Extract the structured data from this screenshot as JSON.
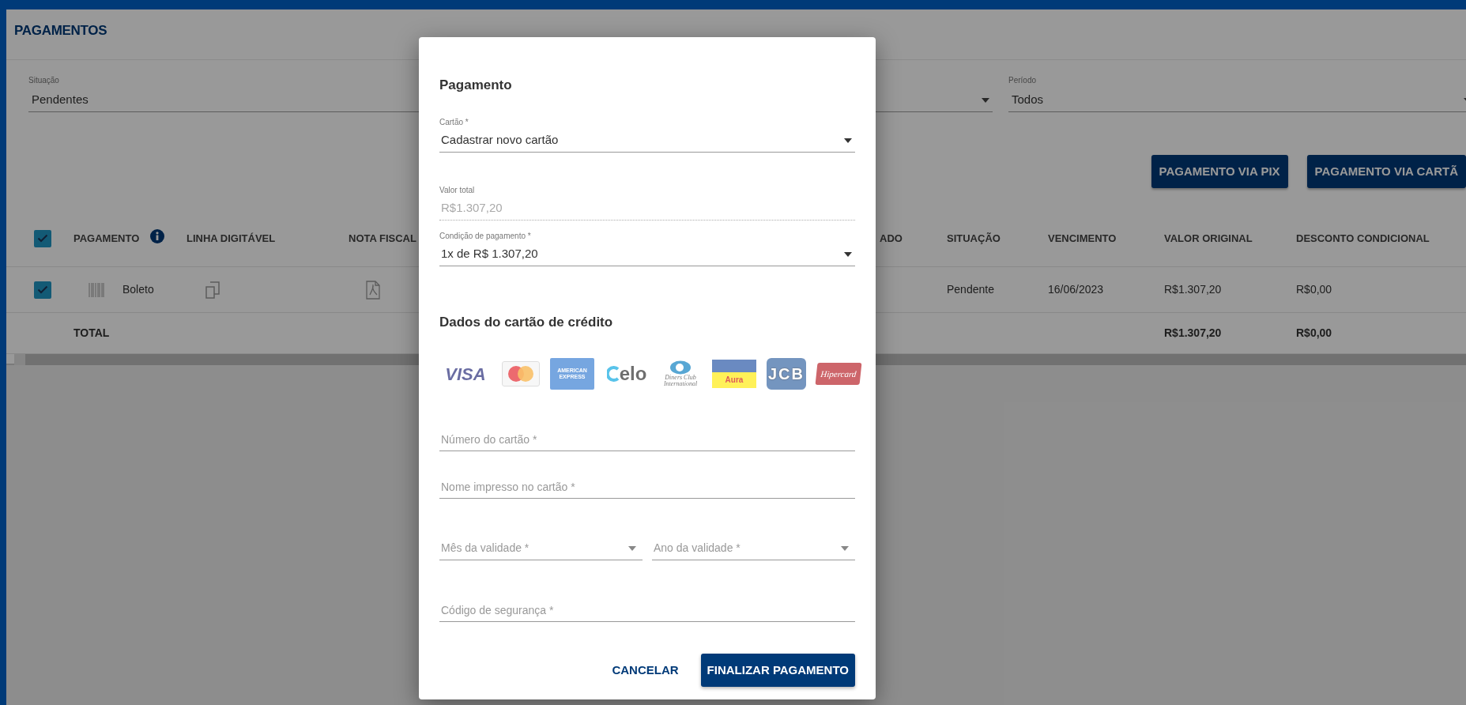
{
  "page": {
    "title": "PAGAMENTOS"
  },
  "filters": [
    {
      "kind": "text",
      "label": "Situação",
      "value": "Pendentes"
    },
    {
      "kind": "select"
    },
    {
      "kind": "select",
      "label": "Período",
      "value": "Todos"
    }
  ],
  "actions": [
    "PAGAMENTO VIA PIX",
    "PAGAMENTO VIA CARTÃ"
  ],
  "table": {
    "select_all_checked": true,
    "columns": [
      {
        "label": "PAGAMENTO",
        "kind": "info"
      },
      {
        "label": "LINHA DIGITÁVEL",
        "kind": "plain"
      },
      {
        "label": "NOTA FISCAL",
        "kind": "plain"
      },
      {
        "label": "ADO",
        "kind": "plain"
      },
      {
        "label": "SITUAÇÃO",
        "kind": "plain"
      },
      {
        "label": "VENCIMENTO",
        "kind": "plain"
      },
      {
        "label": "VALOR ORIGINAL",
        "kind": "plain"
      },
      {
        "label": "DESCONTO CONDICIONAL",
        "kind": "plain"
      }
    ],
    "rows": [
      {
        "checked": true,
        "payment": "Boleto",
        "situacao": "Pendente",
        "vencimento": "16/06/2023",
        "valor_original": "R$1.307,20",
        "desconto": "R$0,00"
      }
    ],
    "total": {
      "label": "TOTAL",
      "valor_original": "R$1.307,20",
      "desconto": "R$0,00"
    }
  },
  "modal": {
    "title": "Pagamento",
    "card_select": {
      "label": "Cartão *",
      "value": "Cadastrar novo cartão"
    },
    "total_field": {
      "label": "Valor total",
      "value": "R$1.307,20",
      "disabled": true
    },
    "condition_select": {
      "label": "Condição de pagamento *",
      "value": "1x de R$ 1.307,20"
    },
    "section_title": "Dados do cartão de crédito",
    "brands": [
      {
        "kind": "visa",
        "label": "VISA"
      },
      {
        "kind": "mastercard"
      },
      {
        "kind": "amex",
        "label": "AMERICAN EXPRESS"
      },
      {
        "kind": "elo",
        "label": "elo"
      },
      {
        "kind": "diners",
        "label": "Diners Club International"
      },
      {
        "kind": "aura",
        "label": "Aura"
      },
      {
        "kind": "jcb",
        "label": "JCB"
      },
      {
        "kind": "hipercard",
        "label": "Hipercard"
      }
    ],
    "field_rows": [
      [
        {
          "kind": "text",
          "placeholder": "Número do cartão *"
        }
      ],
      [
        {
          "kind": "text",
          "placeholder": "Nome impresso no cartão *"
        }
      ],
      [
        {
          "kind": "select",
          "placeholder": "Mês da validade *"
        },
        {
          "kind": "select",
          "placeholder": "Ano da validade *"
        }
      ],
      [
        {
          "kind": "text",
          "placeholder": "Código de segurança *"
        }
      ]
    ],
    "buttons": [
      {
        "kind": "text",
        "label": "CANCELAR"
      },
      {
        "kind": "primary",
        "label": "FINALIZAR PAGAMENTO"
      }
    ]
  }
}
